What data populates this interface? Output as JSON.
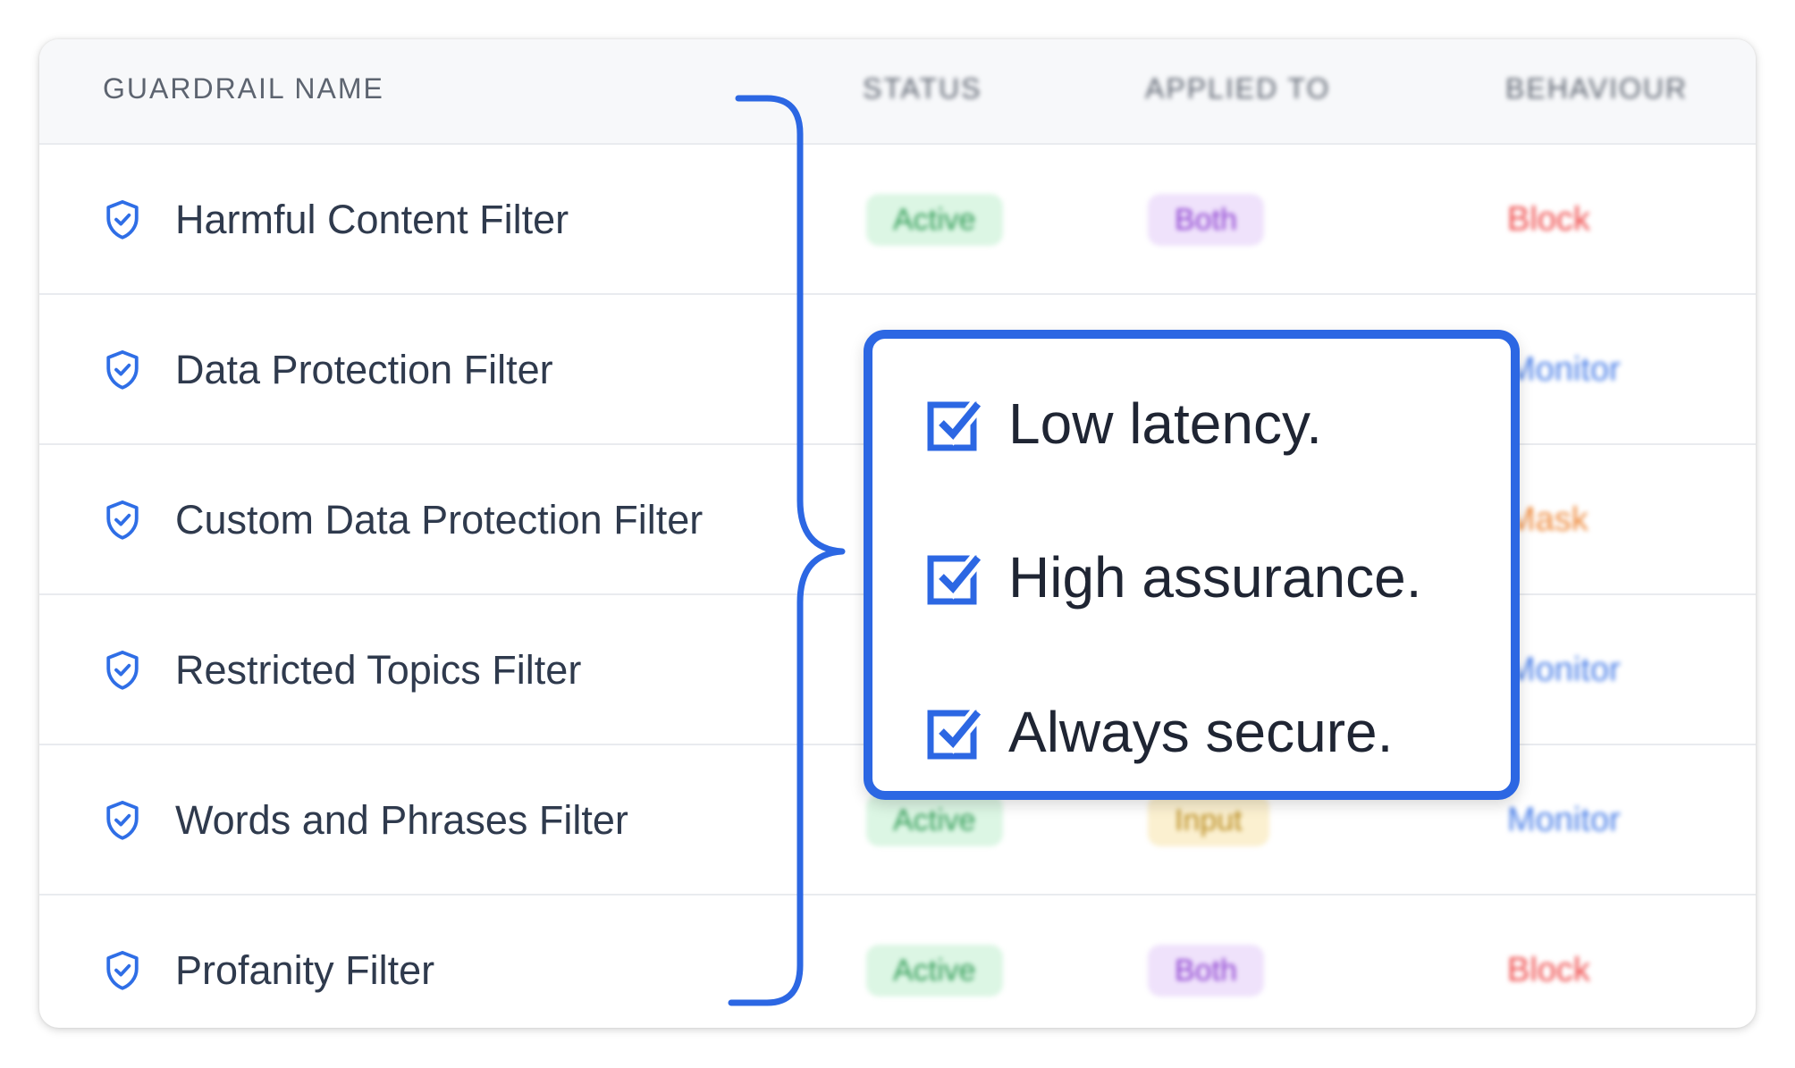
{
  "table": {
    "headers": {
      "name": "GUARDRAIL NAME",
      "status": "STATUS",
      "applied_to": "APPLIED TO",
      "behaviour": "BEHAVIOUR"
    },
    "rows": [
      {
        "name": "Harmful Content Filter",
        "status": "Active",
        "applied_to": "Both",
        "behaviour": "Block"
      },
      {
        "name": "Data Protection Filter",
        "status": "",
        "applied_to": "",
        "behaviour": "Monitor"
      },
      {
        "name": "Custom Data Protection Filter",
        "status": "",
        "applied_to": "",
        "behaviour": "Mask"
      },
      {
        "name": "Restricted Topics Filter",
        "status": "",
        "applied_to": "",
        "behaviour": "Monitor"
      },
      {
        "name": "Words and Phrases Filter",
        "status": "Active",
        "applied_to": "Input",
        "behaviour": "Monitor"
      },
      {
        "name": "Profanity Filter",
        "status": "Active",
        "applied_to": "Both",
        "behaviour": "Block"
      }
    ]
  },
  "callout": {
    "items": [
      {
        "text": "Low latency.",
        "icon": "checked-box-icon"
      },
      {
        "text": "High assurance.",
        "icon": "checked-box-icon"
      },
      {
        "text": "Always secure.",
        "icon": "checked-box-icon"
      }
    ]
  },
  "icons": {
    "row_icon": "shield-check-icon"
  },
  "colors": {
    "accent_blue": "#2c67e3",
    "row_icon_blue": "#2f6ee6",
    "status_active_bg": "#dcf6e4",
    "status_active_text": "#2f9b55",
    "applied_both_bg": "#efe2fb",
    "applied_both_text": "#8c3fd0",
    "applied_input_bg": "#fbf0d0",
    "applied_input_text": "#b88a1c",
    "behaviour_block": "#ef4b4b",
    "behaviour_monitor": "#4a7fe8",
    "behaviour_mask": "#ee8a3c"
  }
}
